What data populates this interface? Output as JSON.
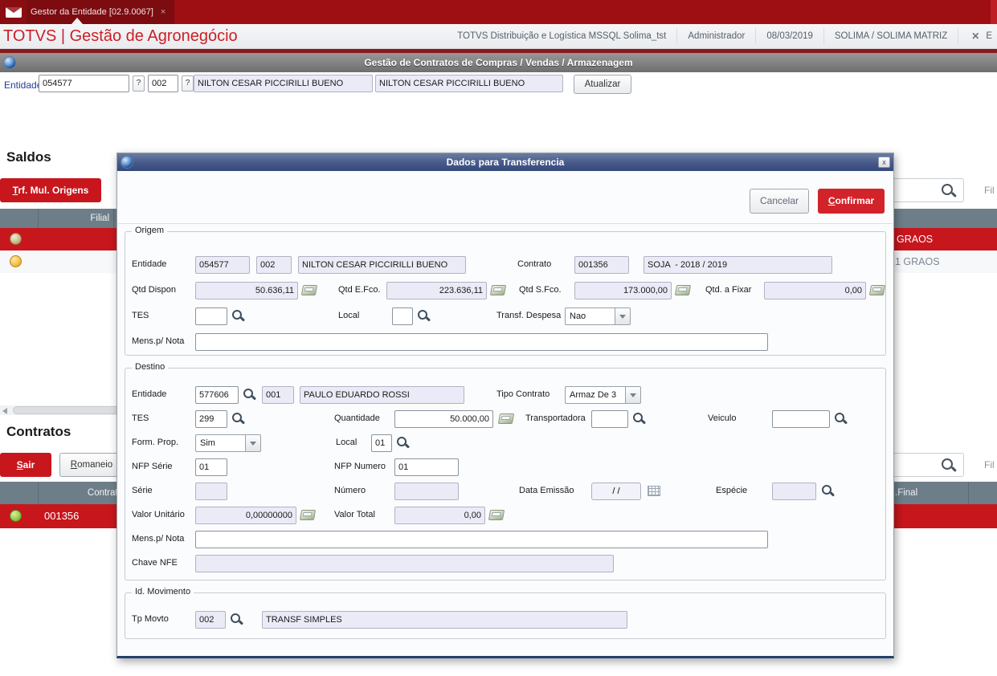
{
  "colors": {
    "brand_red": "#C8161D",
    "confirm_red": "#D2232A",
    "table_header": "#6E7E88",
    "modal_blue": "#46598A"
  },
  "topbar": {
    "tab": "Gestor da Entidade [02.9.0067]",
    "close": "×"
  },
  "menubar": {
    "brand": "TOTVS | Gestão de Agronegócio",
    "env": "TOTVS Distribuição e Logística MSSQL Solima_tst",
    "user": "Administrador",
    "date": "08/03/2019",
    "company": "SOLIMA / SOLIMA MATRIZ",
    "exit": "E"
  },
  "titlebar": {
    "text": "Gestão de Contratos de Compras / Vendas / Armazenagem"
  },
  "entitybar": {
    "label": "Entidade",
    "code": "054577",
    "q1": "?",
    "store": "002",
    "q2": "?",
    "name": "NILTON CESAR PICCIRILLI BUENO",
    "name2": "NILTON CESAR PICCIRILLI BUENO",
    "refresh": "Atualizar"
  },
  "saldos": {
    "title": "Saldos",
    "trf_button": "Trf. Mul. Origens",
    "filter": "Fil",
    "filial_header": "Filial",
    "row1_text": "GRAOS",
    "row2_text": "1 GRAOS"
  },
  "contratos": {
    "title": "Contratos",
    "sair": "Sair",
    "romaneio": "Romaneio",
    "filter": "Fil",
    "contrato_header": "Contrato",
    "final_header": ".Final",
    "row_code": "001356"
  },
  "modal": {
    "title": "Dados para Transferencia",
    "close": "x",
    "cancel": "Cancelar",
    "confirm": "Confirmar",
    "origem": {
      "legend": "Origem",
      "entidade_label": "Entidade",
      "entidade_code": "054577",
      "entidade_loja": "002",
      "entidade_nome": "NILTON CESAR PICCIRILLI BUENO",
      "contrato_label": "Contrato",
      "contrato_code": "001356",
      "contrato_desc": "SOJA  - 2018 / 2019",
      "qtd_dispon_label": "Qtd Dispon",
      "qtd_dispon": "50.636,11",
      "qtd_efco_label": "Qtd E.Fco.",
      "qtd_efco": "223.636,11",
      "qtd_sfco_label": "Qtd S.Fco.",
      "qtd_sfco": "173.000,00",
      "qtd_fixar_label": "Qtd. a Fixar",
      "qtd_fixar": "0,00",
      "tes_label": "TES",
      "local_label": "Local",
      "transf_label": "Transf. Despesa",
      "transf_value": "Nao",
      "mens_label": "Mens.p/ Nota"
    },
    "destino": {
      "legend": "Destino",
      "entidade_label": "Entidade",
      "entidade_code": "577606",
      "entidade_loja": "001",
      "entidade_nome": "PAULO EDUARDO ROSSI",
      "tipo_label": "Tipo Contrato",
      "tipo_value": "Armaz De 3",
      "tes_label": "TES",
      "tes": "299",
      "quantidade_label": "Quantidade",
      "quantidade": "50.000,00",
      "transportadora_label": "Transportadora",
      "veiculo_label": "Veiculo",
      "form_label": "Form. Prop.",
      "form_value": "Sim",
      "local_label": "Local",
      "local": "01",
      "nfp_serie_label": "NFP Série",
      "nfp_serie": "01",
      "nfp_numero_label": "NFP Numero",
      "nfp_numero": "01",
      "serie_label": "Série",
      "numero_label": "Número",
      "data_label": "Data Emissão",
      "data_value": "/ /",
      "especie_label": "Espécie",
      "vlr_unit_label": "Valor Unitário",
      "vlr_unit": "0,00000000",
      "vlr_total_label": "Valor Total",
      "vlr_total": "0,00",
      "mens_label": "Mens.p/ Nota",
      "chave_label": "Chave NFE"
    },
    "movimento": {
      "legend": "Id. Movimento",
      "tp_label": "Tp Movto",
      "tp_code": "002",
      "tp_desc": "TRANSF SIMPLES"
    }
  }
}
